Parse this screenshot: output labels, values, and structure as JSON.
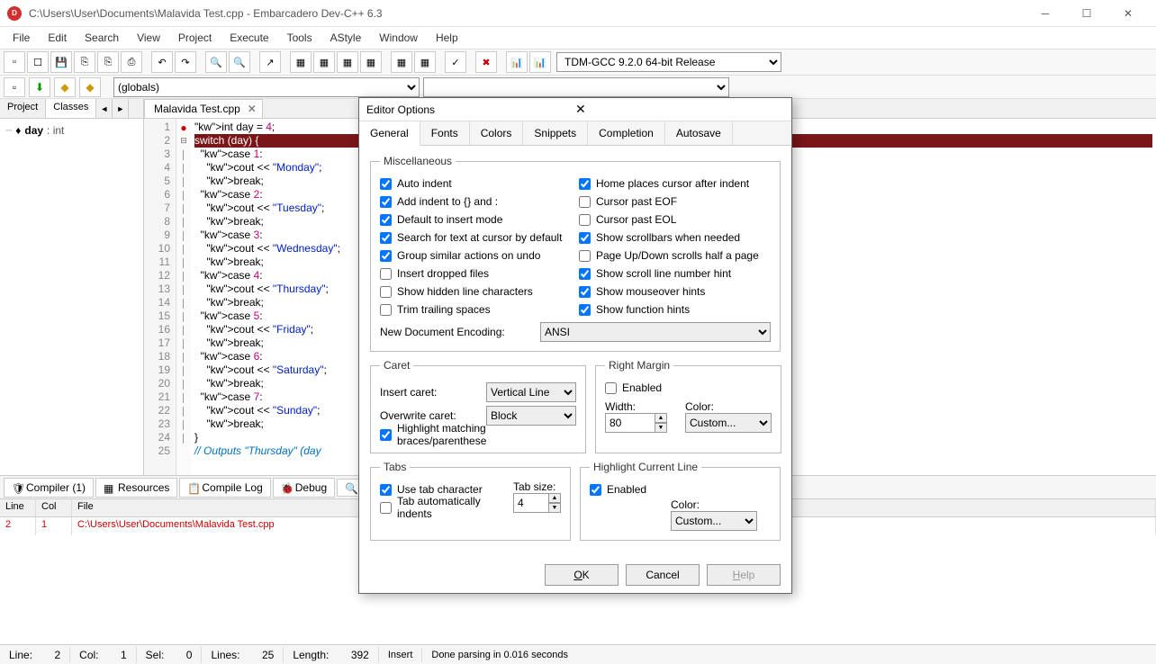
{
  "titlebar": {
    "path": "C:\\Users\\User\\Documents\\Malavida Test.cpp - Embarcadero Dev-C++ 6.3"
  },
  "menu": [
    "File",
    "Edit",
    "Search",
    "View",
    "Project",
    "Execute",
    "Tools",
    "AStyle",
    "Window",
    "Help"
  ],
  "compiler_select": "TDM-GCC 9.2.0 64-bit Release",
  "globals_select": "(globals)",
  "side_tabs": {
    "project": "Project",
    "classes": "Classes"
  },
  "tree": {
    "name": "day",
    "type": ": int"
  },
  "editor_tab": "Malavida Test.cpp",
  "code_lines": [
    "int day = 4;",
    "switch (day) {",
    "  case 1:",
    "    cout << \"Monday\";",
    "    break;",
    "  case 2:",
    "    cout << \"Tuesday\";",
    "    break;",
    "  case 3:",
    "    cout << \"Wednesday\";",
    "    break;",
    "  case 4:",
    "    cout << \"Thursday\";",
    "    break;",
    "  case 5:",
    "    cout << \"Friday\";",
    "    break;",
    "  case 6:",
    "    cout << \"Saturday\";",
    "    break;",
    "  case 7:",
    "    cout << \"Sunday\";",
    "    break;",
    "}",
    "// Outputs \"Thursday\" (day"
  ],
  "bottom_tabs": {
    "compiler": "Compiler (1)",
    "resources": "Resources",
    "compile_log": "Compile Log",
    "debug": "Debug"
  },
  "grid_head": {
    "line": "Line",
    "col": "Col",
    "file": "File"
  },
  "grid_row": {
    "line": "2",
    "col": "1",
    "file": "C:\\Users\\User\\Documents\\Malavida Test.cpp"
  },
  "status": {
    "line": "Line:",
    "line_v": "2",
    "col": "Col:",
    "col_v": "1",
    "sel": "Sel:",
    "sel_v": "0",
    "lines": "Lines:",
    "lines_v": "25",
    "len": "Length:",
    "len_v": "392",
    "ins": "Insert",
    "parse": "Done parsing in 0.016 seconds"
  },
  "dialog": {
    "title": "Editor Options",
    "tabs": [
      "General",
      "Fonts",
      "Colors",
      "Snippets",
      "Completion",
      "Autosave"
    ],
    "misc": {
      "legend": "Miscellaneous",
      "left": [
        {
          "label": "Auto indent",
          "checked": true
        },
        {
          "label": "Add indent to {} and :",
          "checked": true
        },
        {
          "label": "Default to insert mode",
          "checked": true
        },
        {
          "label": "Search for text at cursor by default",
          "checked": true
        },
        {
          "label": "Group similar actions on undo",
          "checked": true
        },
        {
          "label": "Insert dropped files",
          "checked": false
        },
        {
          "label": "Show hidden line characters",
          "checked": false
        },
        {
          "label": "Trim trailing spaces",
          "checked": false
        }
      ],
      "right": [
        {
          "label": "Home places cursor after indent",
          "checked": true
        },
        {
          "label": "Cursor past EOF",
          "checked": false
        },
        {
          "label": "Cursor past EOL",
          "checked": false
        },
        {
          "label": "Show scrollbars when needed",
          "checked": true
        },
        {
          "label": "Page Up/Down scrolls half a page",
          "checked": false
        },
        {
          "label": "Show scroll line number hint",
          "checked": true
        },
        {
          "label": "Show mouseover hints",
          "checked": true
        },
        {
          "label": "Show function hints",
          "checked": true
        }
      ],
      "encoding_label": "New Document Encoding:",
      "encoding": "ANSI"
    },
    "caret": {
      "legend": "Caret",
      "insert_label": "Insert caret:",
      "insert": "Vertical Line",
      "overwrite_label": "Overwrite caret:",
      "overwrite": "Block",
      "highlight": {
        "label": "Highlight matching braces/parenthese",
        "checked": true
      }
    },
    "margin": {
      "legend": "Right Margin",
      "enabled": {
        "label": "Enabled",
        "checked": false
      },
      "width_label": "Width:",
      "width": "80",
      "color_label": "Color:",
      "color": "Custom..."
    },
    "tabs_fs": {
      "legend": "Tabs",
      "use": {
        "label": "Use tab character",
        "checked": true
      },
      "auto": {
        "label": "Tab automatically indents",
        "checked": false
      },
      "size_label": "Tab size:",
      "size": "4"
    },
    "hcl": {
      "legend": "Highlight Current Line",
      "enabled": {
        "label": "Enabled",
        "checked": true
      },
      "color_label": "Color:",
      "color": "Custom..."
    },
    "btns": {
      "ok": "OK",
      "cancel": "Cancel",
      "help": "Help"
    }
  }
}
